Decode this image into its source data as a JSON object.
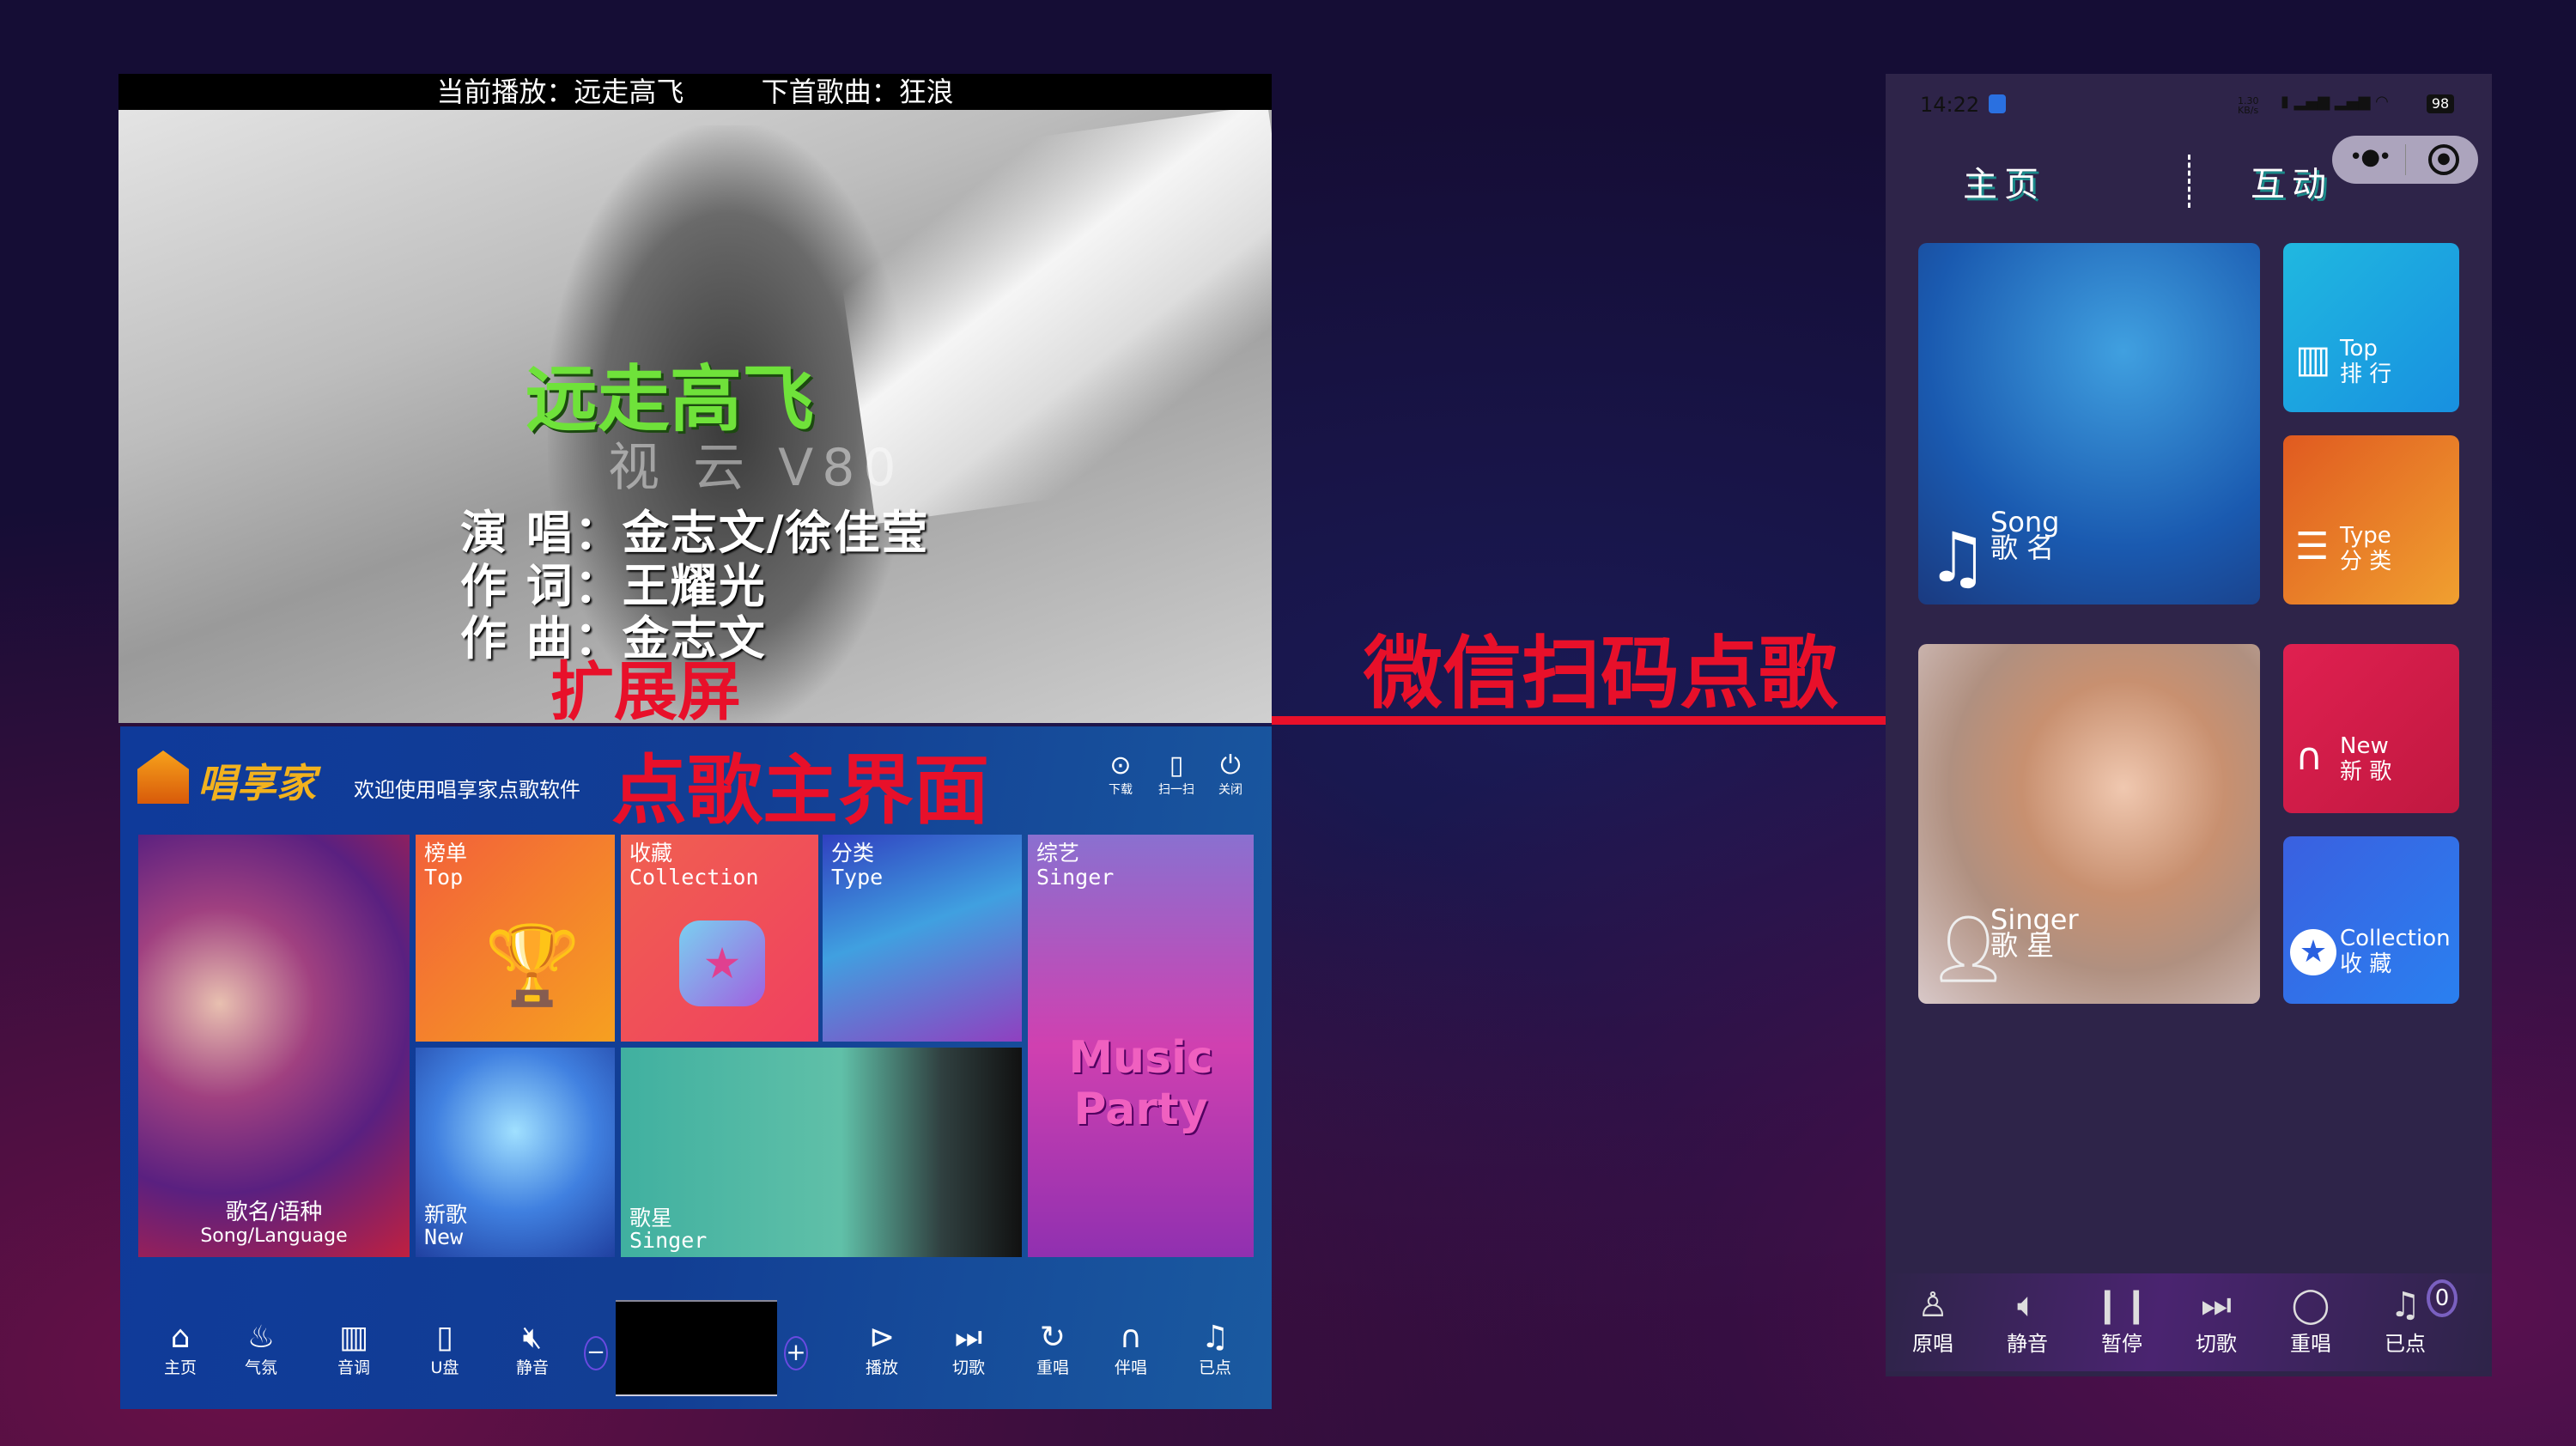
{
  "video": {
    "now_playing": "当前播放：远走高飞",
    "next_song": "下首歌曲：狂浪",
    "song_title": "远走高飞",
    "singer_line": "演 唱：金志文/徐佳莹",
    "lyricist_line": "作 词：王耀光",
    "composer_line": "作 曲：金志文",
    "label": "扩展屏",
    "watermark": "视 云 V80"
  },
  "annotations": {
    "main_ui": "点歌主界面",
    "wechat": "微信扫码点歌"
  },
  "app": {
    "logo": "唱享家",
    "welcome": "欢迎使用唱享家点歌软件",
    "header_buttons": [
      {
        "icon": "download-icon",
        "label": "下载"
      },
      {
        "icon": "phone-icon",
        "label": "扫一扫"
      },
      {
        "icon": "power-icon",
        "label": "关闭"
      }
    ],
    "tiles": {
      "song": {
        "cn": "歌名/语种",
        "en": "Song/Language"
      },
      "top": {
        "cn": "榜单",
        "en": "Top"
      },
      "collection": {
        "cn": "收藏",
        "en": "Collection"
      },
      "type": {
        "cn": "分类",
        "en": "Type"
      },
      "variety": {
        "cn": "综艺",
        "en": "Singer",
        "art": "Music Party"
      },
      "new": {
        "cn": "新歌",
        "en": "New"
      },
      "singer": {
        "cn": "歌星",
        "en": "Singer"
      }
    },
    "bottom": [
      "主页",
      "气氛",
      "音调",
      "U盘",
      "静音",
      "播放",
      "切歌",
      "重唱",
      "伴唱",
      "已点"
    ],
    "minus": "−",
    "plus": "+"
  },
  "phone": {
    "status": {
      "time": "14:22",
      "speed": "1.30 KB/s",
      "battery": "98"
    },
    "tabs": [
      "主页",
      "互动"
    ],
    "tiles": {
      "song": {
        "en": "Song",
        "cn": "歌 名"
      },
      "top": {
        "en": "Top",
        "cn": "排 行"
      },
      "type": {
        "en": "Type",
        "cn": "分 类"
      },
      "singer": {
        "en": "Singer",
        "cn": "歌 星"
      },
      "new": {
        "en": "New",
        "cn": "新 歌"
      },
      "collection": {
        "en": "Collection",
        "cn": "收 藏"
      }
    },
    "bottom": [
      "原唱",
      "静音",
      "暂停",
      "切歌",
      "重唱",
      "已点"
    ],
    "queue_count": "0"
  },
  "colors": {
    "annotation_red": "#e8102a",
    "app_blue": "#123e94",
    "phone_bg": "#2e2449"
  }
}
